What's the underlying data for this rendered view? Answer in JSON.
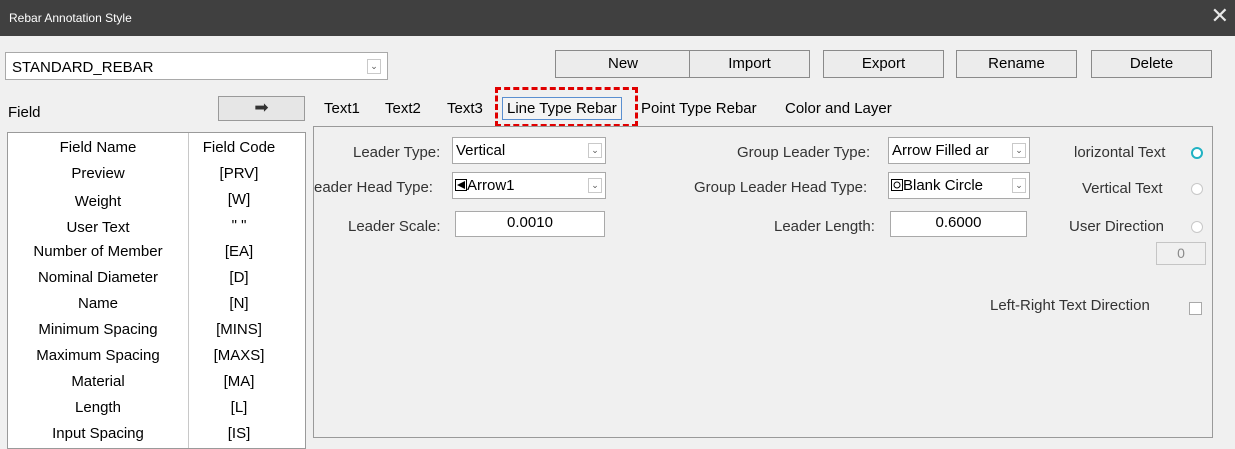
{
  "window": {
    "title": "Rebar Annotation Style",
    "close_glyph": "✕"
  },
  "style_select": {
    "value": "STANDARD_REBAR",
    "arrow": "⌄"
  },
  "toolbar": {
    "new": "New",
    "import": "Import",
    "export": "Export",
    "rename": "Rename",
    "delete": "Delete"
  },
  "field_panel": {
    "label": "Field",
    "arrow": "➡",
    "headers": {
      "name": "Field Name",
      "code": "Field Code"
    },
    "rows": [
      {
        "name": "Preview",
        "code": "[PRV]"
      },
      {
        "name": "Weight",
        "code": "[W]"
      },
      {
        "name": "User Text",
        "code": "\" \""
      },
      {
        "name": "Number of Member",
        "code": "[EA]"
      },
      {
        "name": "Nominal Diameter",
        "code": "[D]"
      },
      {
        "name": "Name",
        "code": "[N]"
      },
      {
        "name": "Minimum Spacing",
        "code": "[MINS]"
      },
      {
        "name": "Maximum Spacing",
        "code": "[MAXS]"
      },
      {
        "name": "Material",
        "code": "[MA]"
      },
      {
        "name": "Length",
        "code": "[L]"
      },
      {
        "name": "Input Spacing",
        "code": "[IS]"
      }
    ]
  },
  "tabs": [
    {
      "label": "Text1"
    },
    {
      "label": "Text2"
    },
    {
      "label": "Text3"
    },
    {
      "label": "Line Type Rebar",
      "active": true
    },
    {
      "label": "Point Type Rebar"
    },
    {
      "label": "Color and Layer"
    }
  ],
  "line_type": {
    "leader_type_label": "Leader Type:",
    "leader_type_value": "Vertical",
    "leader_head_type_label": "eader Head Type:",
    "leader_head_type_value": "Arrow1",
    "leader_scale_label": "Leader Scale:",
    "leader_scale_value": "0.0010",
    "group_leader_type_label": "Group Leader Type:",
    "group_leader_type_value": "Arrow Filled ar",
    "group_leader_head_type_label": "Group Leader Head Type:",
    "group_leader_head_type_value": "Blank Circle",
    "leader_length_label": "Leader Length:",
    "leader_length_value": "0.6000",
    "horizontal_text_label": "lorizontal Text",
    "vertical_text_label": "Vertical Text",
    "user_direction_label": "User Direction",
    "user_direction_value": "0",
    "left_right_label": "Left-Right Text Direction",
    "dropdown_arrow": "⌄",
    "selected_option": "Horizontal Text"
  },
  "colors": {
    "titlebar": "#404040",
    "radio_selected": "#21b2c3",
    "highlight": "#e00000",
    "tab_border": "#5a8fd0"
  }
}
